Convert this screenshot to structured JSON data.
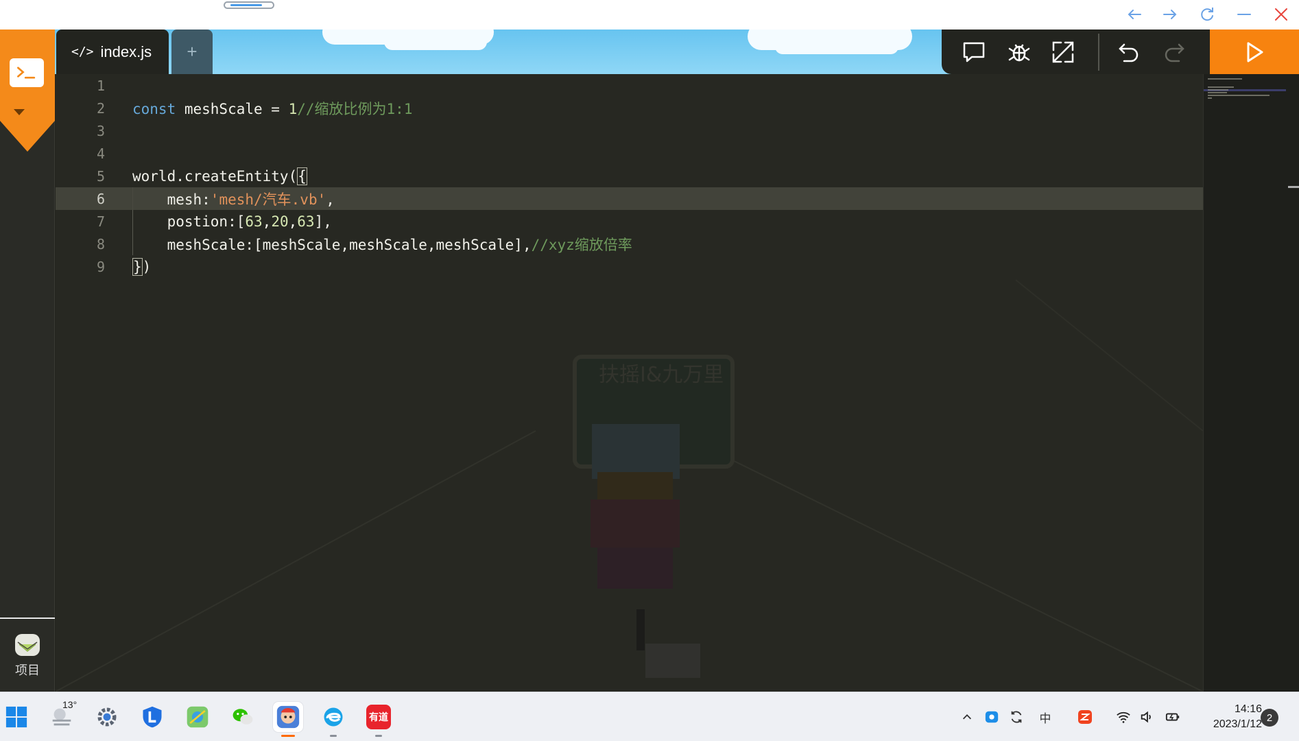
{
  "window": {
    "nav_back": "←",
    "nav_forward": "→"
  },
  "sidebar": {
    "project_label": "项目"
  },
  "tabs": [
    {
      "label": "index.js",
      "icon": "code-icon",
      "active": true
    },
    {
      "label": "+",
      "icon": "add-icon",
      "active": false
    }
  ],
  "toolbar": {
    "tools": [
      "comment-icon",
      "debug-bug-icon",
      "fullscreen-icon",
      "undo-icon",
      "redo-icon"
    ],
    "run": "play-icon"
  },
  "editor": {
    "current_line": 6,
    "line_numbers": [
      "1",
      "2",
      "3",
      "4",
      "5",
      "6",
      "7",
      "8",
      "9"
    ],
    "lines": [
      [],
      [
        {
          "t": "kw",
          "v": "const"
        },
        {
          "t": "txt",
          "v": " meshScale = "
        },
        {
          "t": "num",
          "v": "1"
        },
        {
          "t": "cmt",
          "v": "//缩放比例为1:1"
        }
      ],
      [],
      [],
      [
        {
          "t": "txt",
          "v": "world.createEntity("
        },
        {
          "t": "box",
          "v": "{"
        }
      ],
      [
        {
          "t": "txt",
          "v": "    mesh:"
        },
        {
          "t": "str",
          "v": "'mesh/汽车.vb'"
        },
        {
          "t": "txt",
          "v": ","
        }
      ],
      [
        {
          "t": "txt",
          "v": "    postion:["
        },
        {
          "t": "num",
          "v": "63"
        },
        {
          "t": "txt",
          "v": ","
        },
        {
          "t": "num",
          "v": "20"
        },
        {
          "t": "txt",
          "v": ","
        },
        {
          "t": "num",
          "v": "63"
        },
        {
          "t": "txt",
          "v": "],"
        }
      ],
      [
        {
          "t": "txt",
          "v": "    meshScale:[meshScale,meshScale,meshScale],"
        },
        {
          "t": "cmt",
          "v": "//xyz缩放倍率"
        }
      ],
      [
        {
          "t": "box",
          "v": "}"
        },
        {
          "t": "txt",
          "v": ")"
        }
      ]
    ]
  },
  "scene": {
    "sign_text": "扶摇I&九万里"
  },
  "taskbar": {
    "weather_temp": "13°",
    "apps": [
      "windows-start-icon",
      "weather-icon",
      "settings-gear-icon",
      "l-app-icon",
      "maps-app-icon",
      "wechat-icon",
      "code-game-app-icon",
      "edge-browser-icon",
      "youdao-dict-icon"
    ],
    "youdao_label": "有道",
    "tray": [
      "chevron-up-icon",
      "tray-app-icon",
      "sync-icon",
      "ime-icon",
      "wps-icon",
      "wifi-icon",
      "volume-icon",
      "battery-icon"
    ],
    "ime_label": "中",
    "time": "14:16",
    "date": "2023/1/12",
    "notifications": "2"
  },
  "colors": {
    "accent_orange": "#f7830f",
    "editor_bg": "#272822",
    "keyword": "#66a8d9",
    "string": "#e2925b",
    "comment": "#6e9a5c"
  }
}
